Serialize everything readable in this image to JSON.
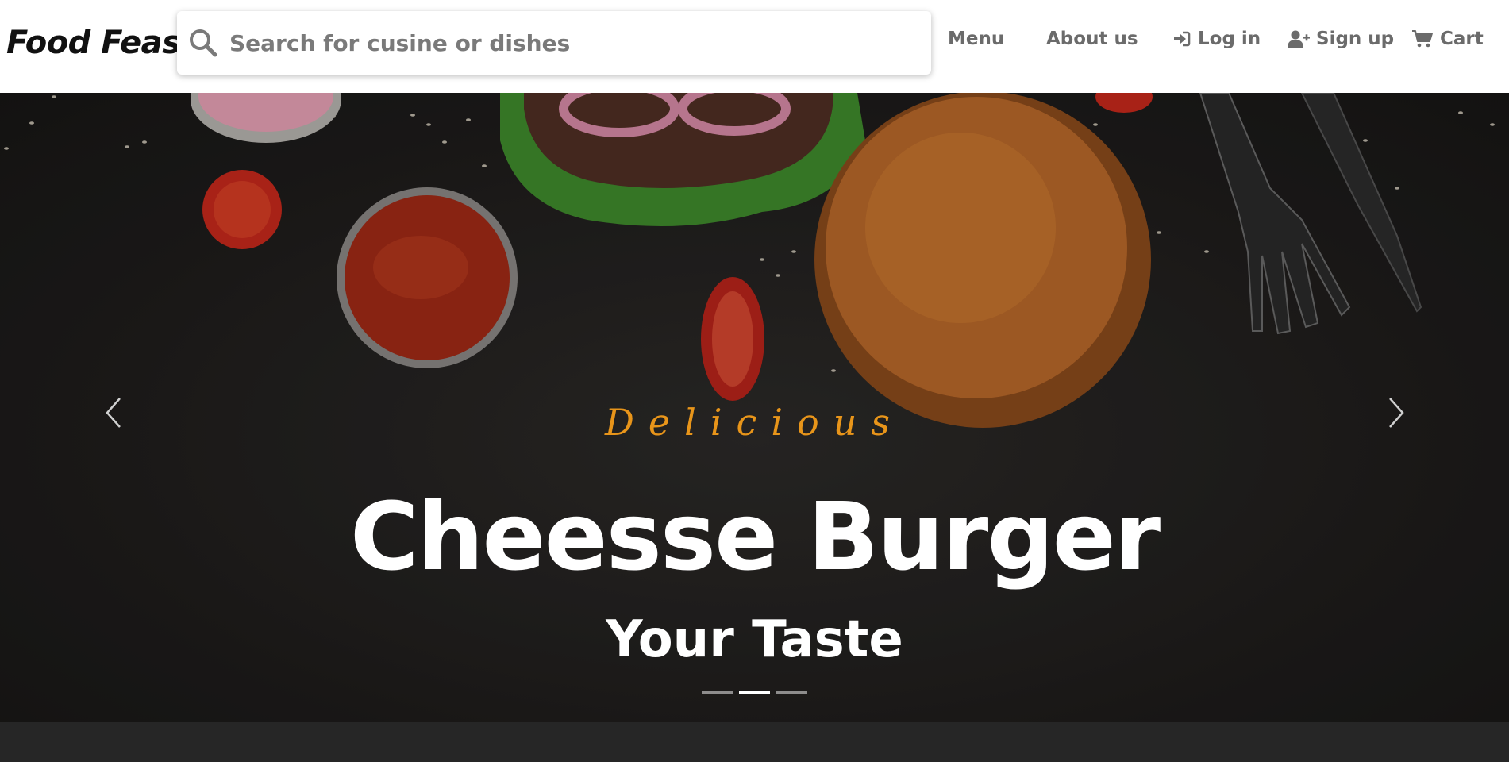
{
  "brand": {
    "logo_text": "Food Feast"
  },
  "search": {
    "placeholder": "Search for cusine or dishes",
    "value": ""
  },
  "nav": {
    "menu": "Menu",
    "about": "About us",
    "login": "Log in",
    "signup": "Sign up",
    "cart": "Cart",
    "icons": [
      "search-icon",
      "login-icon",
      "user-plus-icon",
      "cart-icon"
    ]
  },
  "hero": {
    "eyebrow": "Delicious",
    "headline": "Cheesse Burger",
    "subline": "Your Taste",
    "slide_count": 3,
    "active_slide": 2
  },
  "colors": {
    "accent": "#e8951a",
    "nav_text": "#6b6b6b",
    "hero_bg": "#1f1d1c",
    "footer_bg": "#262626"
  }
}
